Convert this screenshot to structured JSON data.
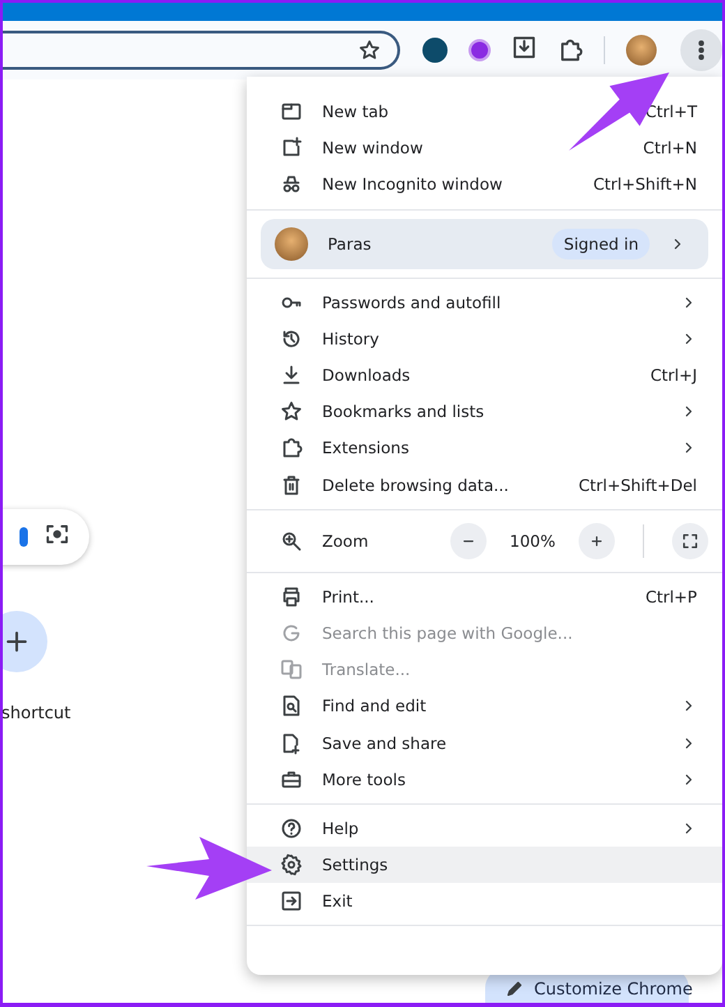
{
  "menu": {
    "sections": [
      {
        "items": [
          {
            "kind": "item",
            "label": "New tab",
            "shortcut": "Ctrl+T",
            "submenu": false,
            "disabled": false,
            "selected": false
          },
          {
            "kind": "item",
            "label": "New window",
            "shortcut": "Ctrl+N",
            "submenu": false,
            "disabled": false,
            "selected": false
          },
          {
            "kind": "item",
            "label": "New Incognito window",
            "shortcut": "Ctrl+Shift+N",
            "submenu": false,
            "disabled": false,
            "selected": false
          }
        ]
      },
      {
        "items": [
          {
            "kind": "profile",
            "label": "Paras",
            "badge": "Signed in",
            "submenu": true,
            "disabled": false,
            "selected": false
          }
        ]
      },
      {
        "items": [
          {
            "kind": "item",
            "label": "Passwords and autofill",
            "submenu": true,
            "disabled": false,
            "selected": false
          },
          {
            "kind": "item",
            "label": "History",
            "submenu": true,
            "disabled": false,
            "selected": false
          },
          {
            "kind": "item",
            "label": "Downloads",
            "shortcut": "Ctrl+J",
            "submenu": false,
            "disabled": false,
            "selected": false
          },
          {
            "kind": "item",
            "label": "Bookmarks and lists",
            "submenu": true,
            "disabled": false,
            "selected": false
          },
          {
            "kind": "item",
            "label": "Extensions",
            "submenu": true,
            "disabled": false,
            "selected": false
          },
          {
            "kind": "item",
            "label": "Delete browsing data...",
            "shortcut": "Ctrl+Shift+Del",
            "submenu": false,
            "disabled": false,
            "selected": false
          }
        ]
      },
      {
        "items": [
          {
            "kind": "zoom",
            "label": "Zoom",
            "value": "100%",
            "disabled": false,
            "selected": false
          }
        ]
      },
      {
        "items": [
          {
            "kind": "item",
            "label": "Print...",
            "shortcut": "Ctrl+P",
            "submenu": false,
            "disabled": false,
            "selected": false
          },
          {
            "kind": "item",
            "label": "Search this page with Google...",
            "submenu": false,
            "disabled": true,
            "selected": false
          },
          {
            "kind": "item",
            "label": "Translate...",
            "submenu": false,
            "disabled": true,
            "selected": false
          },
          {
            "kind": "item",
            "label": "Find and edit",
            "submenu": true,
            "disabled": false,
            "selected": false
          },
          {
            "kind": "item",
            "label": "Save and share",
            "submenu": true,
            "disabled": false,
            "selected": false
          },
          {
            "kind": "item",
            "label": "More tools",
            "submenu": true,
            "disabled": false,
            "selected": false
          }
        ]
      },
      {
        "items": [
          {
            "kind": "item",
            "label": "Help",
            "submenu": true,
            "disabled": false,
            "selected": false
          },
          {
            "kind": "item",
            "label": "Settings",
            "submenu": false,
            "disabled": false,
            "selected": true
          },
          {
            "kind": "item",
            "label": "Exit",
            "submenu": false,
            "disabled": false,
            "selected": false
          }
        ]
      }
    ]
  },
  "page": {
    "shortcut_label": "shortcut",
    "customize_button": "Customize Chrome"
  }
}
